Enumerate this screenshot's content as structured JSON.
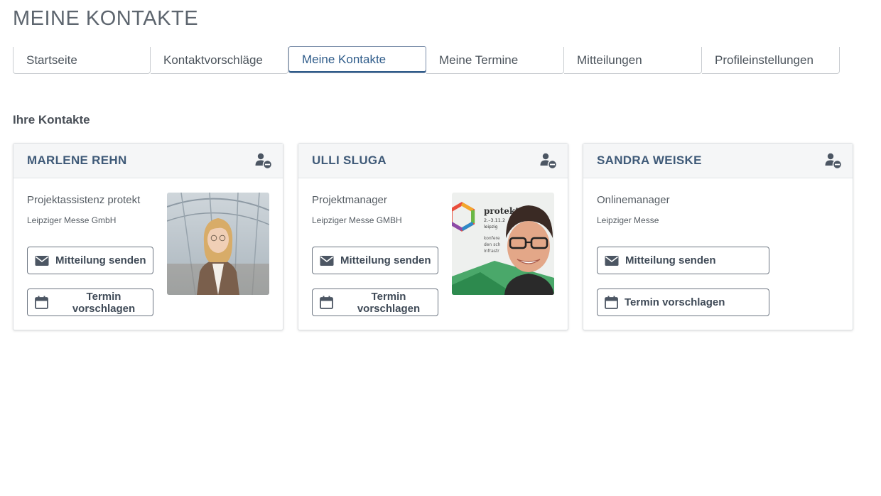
{
  "page": {
    "title": "MEINE KONTAKTE"
  },
  "tabs": [
    {
      "label": "Startseite",
      "active": false
    },
    {
      "label": "Kontaktvorschläge",
      "active": false
    },
    {
      "label": "Meine Kontakte",
      "active": true
    },
    {
      "label": "Meine Termine",
      "active": false
    },
    {
      "label": "Mitteilungen",
      "active": false
    },
    {
      "label": "Profileinstellungen",
      "active": false
    }
  ],
  "section": {
    "title": "Ihre Kontakte"
  },
  "contacts": [
    {
      "name": "MARLENE REHN",
      "role": "Projektassistenz protekt",
      "company": "Leipziger Messe GmbH"
    },
    {
      "name": "ULLI SLUGA",
      "role": "Projektmanager",
      "company": "Leipziger Messe GMBH",
      "photo_text": [
        "protekt",
        "2.–3.11.2",
        "leipzig",
        "konfere",
        "den sch",
        "Infrastr"
      ]
    },
    {
      "name": "SANDRA WEISKE",
      "role": "Onlinemanager",
      "company": "Leipziger Messe"
    }
  ],
  "actions": {
    "message_label": "Mitteilung senden",
    "appointment_label": "Termin vorschlagen",
    "message_icon": "envelope-icon",
    "appointment_icon": "calendar-icon",
    "remove_icon": "remove-contact-icon"
  },
  "colors": {
    "accent": "#2f5c8a",
    "name_text": "#3f5a78",
    "card_header_bg": "#f5f6f7"
  }
}
